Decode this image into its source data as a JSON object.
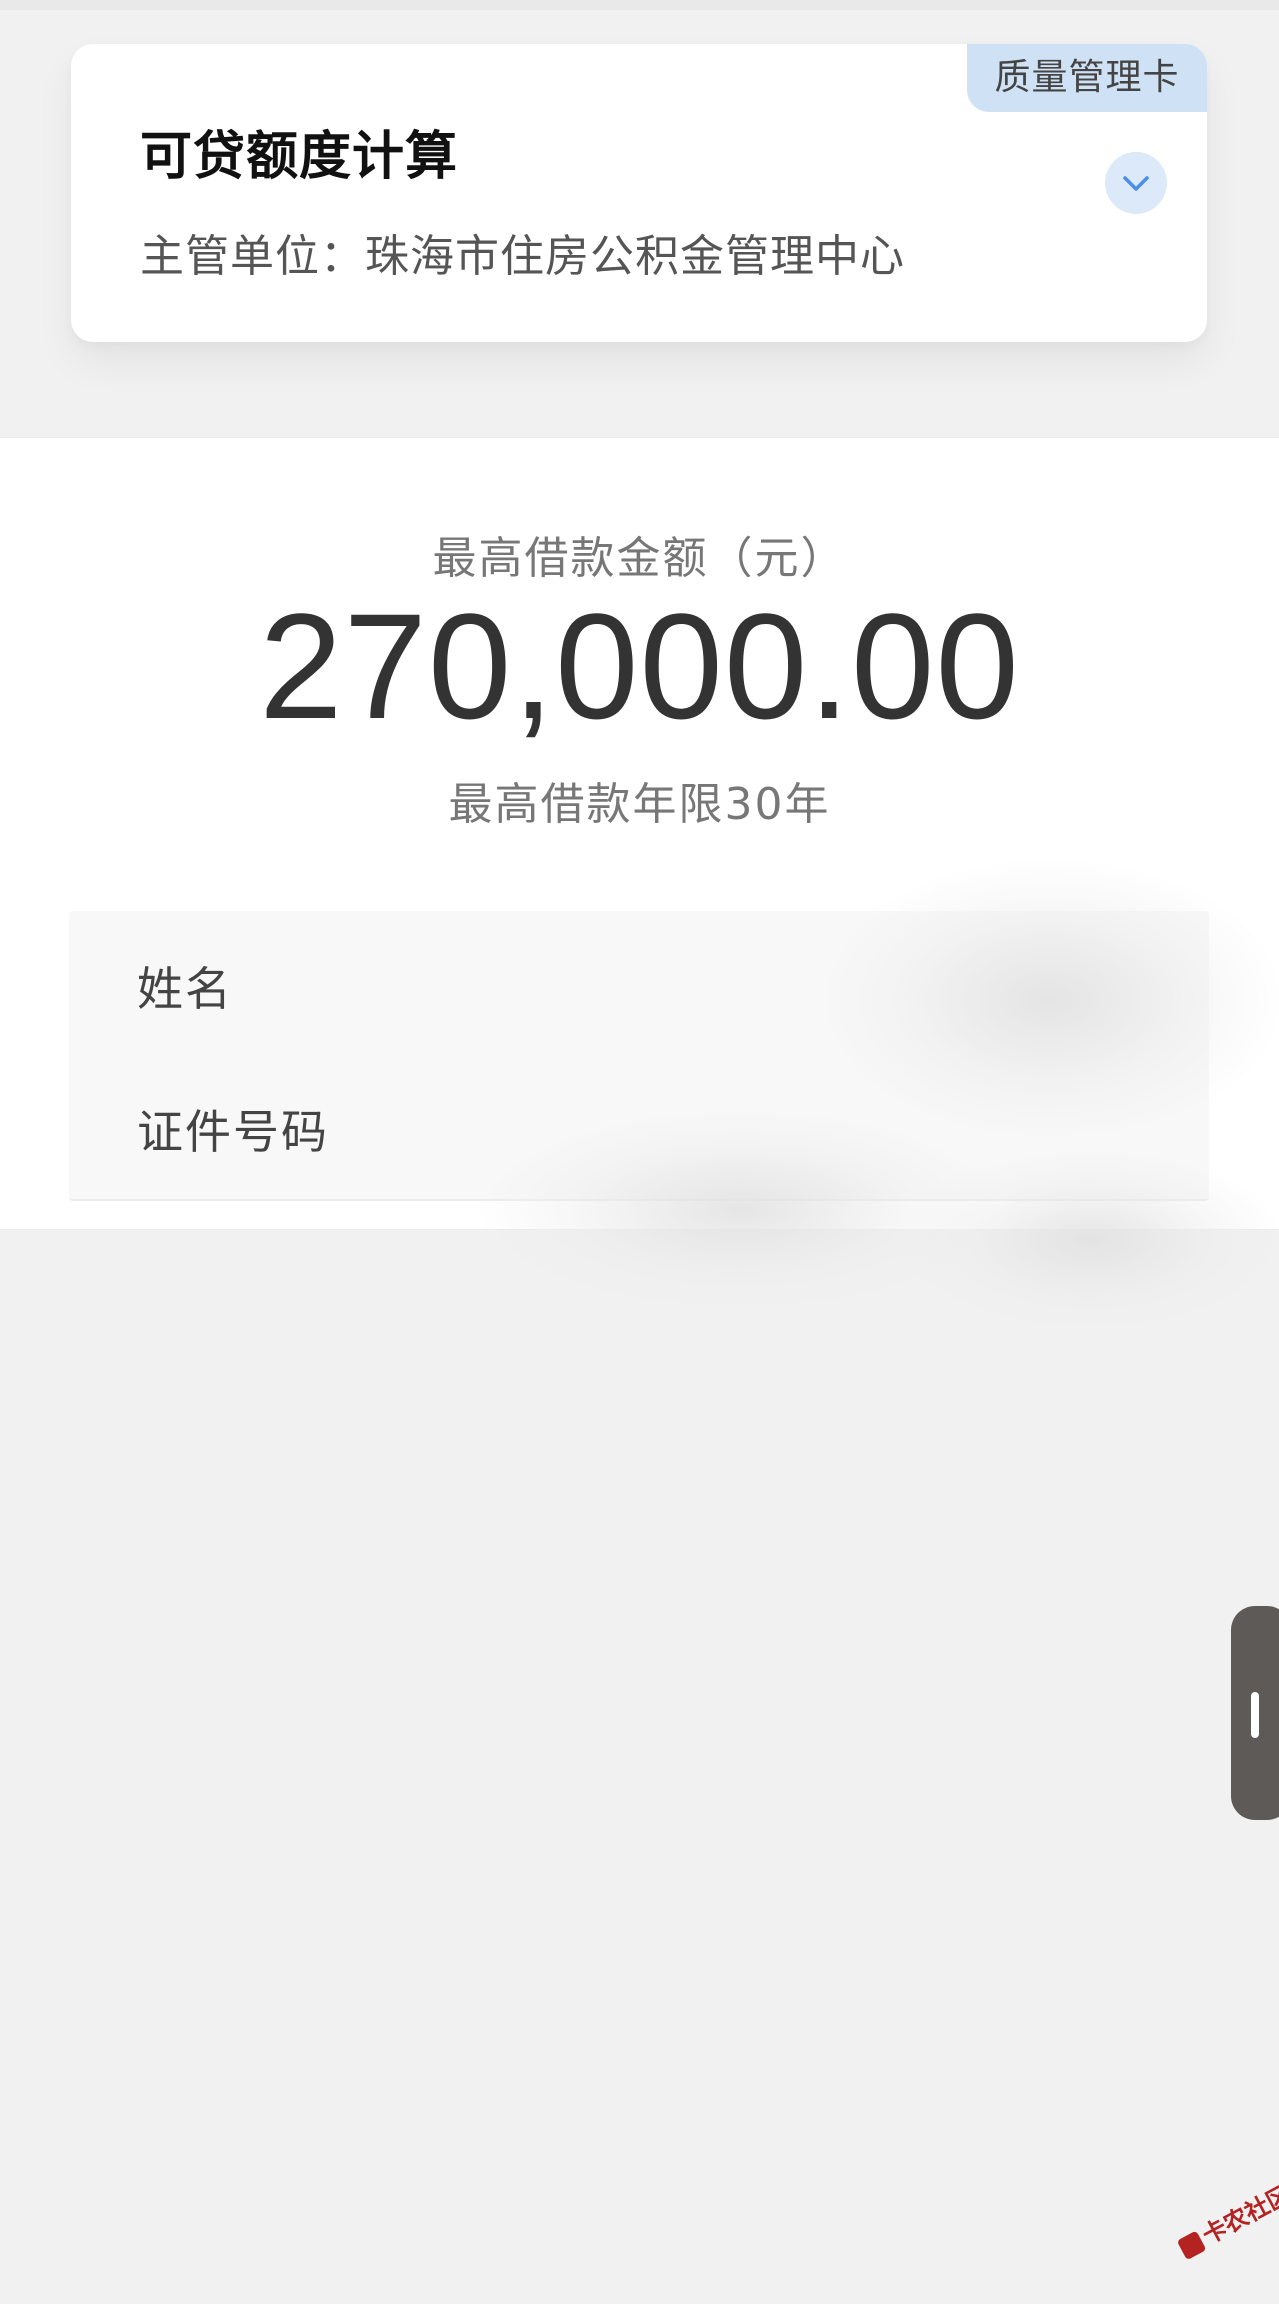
{
  "card": {
    "title": "可贷额度计算",
    "subtitle": "主管单位：珠海市住房公积金管理中心",
    "badge": "质量管理卡",
    "expand_icon": "chevron-down-icon"
  },
  "loan": {
    "amount_label": "最高借款金额（元）",
    "amount_value": "270,000.00",
    "term_text": "最高借款年限30年"
  },
  "form": {
    "name_label": "姓名",
    "name_value": "",
    "id_label": "证件号码",
    "id_value": ""
  },
  "side_handle": {
    "icon": "drag-handle-icon"
  },
  "watermark": {
    "text": "卡农社区"
  },
  "colors": {
    "badge_bg": "#cfe1f5",
    "accent_blue": "#4a8ee6",
    "handle_bg": "#5e5a57",
    "watermark_red": "#b42222"
  }
}
